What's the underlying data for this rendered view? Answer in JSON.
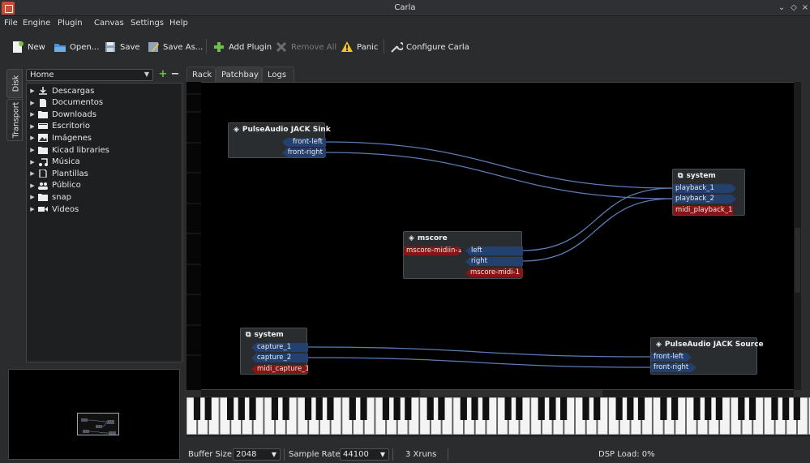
{
  "window": {
    "title": "Carla",
    "controls": [
      "⌄",
      "◇",
      "×"
    ]
  },
  "menubar": {
    "items": [
      "File",
      "Engine",
      "Plugin",
      "Canvas",
      "Settings",
      "Help"
    ]
  },
  "toolbar": {
    "new": "New",
    "open": "Open...",
    "save": "Save",
    "save_as": "Save As...",
    "add_plugin": "Add Plugin",
    "remove_all": "Remove All",
    "panic": "Panic",
    "configure": "Configure Carla"
  },
  "sidebar": {
    "tabs": [
      "Disk",
      "Transport"
    ],
    "path": "Home",
    "items": [
      {
        "label": "Descargas",
        "icon": "download-icon"
      },
      {
        "label": "Documentos",
        "icon": "document-icon"
      },
      {
        "label": "Downloads",
        "icon": "folder-icon"
      },
      {
        "label": "Escritorio",
        "icon": "desktop-icon"
      },
      {
        "label": "Imágenes",
        "icon": "image-icon"
      },
      {
        "label": "Kicad libraries",
        "icon": "folder-icon"
      },
      {
        "label": "Música",
        "icon": "music-icon"
      },
      {
        "label": "Plantillas",
        "icon": "template-icon"
      },
      {
        "label": "Público",
        "icon": "people-icon"
      },
      {
        "label": "snap",
        "icon": "folder-icon"
      },
      {
        "label": "Videos",
        "icon": "video-icon"
      }
    ]
  },
  "tabs": [
    "Rack",
    "Patchbay",
    "Logs"
  ],
  "patchbay": {
    "nodes": {
      "pulse_sink": {
        "title": "PulseAudio JACK Sink",
        "ports": [
          "front-left",
          "front-right"
        ]
      },
      "system_out": {
        "title": "system",
        "ports": [
          "playback_1",
          "playback_2",
          "midi_playback_1"
        ]
      },
      "mscore": {
        "title": "mscore",
        "in_ports": [
          "mscore-midiin-1"
        ],
        "out_ports": [
          "left",
          "right",
          "mscore-midi-1"
        ]
      },
      "system_in": {
        "title": "system",
        "ports": [
          "capture_1",
          "capture_2",
          "midi_capture_1"
        ]
      },
      "pulse_source": {
        "title": "PulseAudio JACK Source",
        "ports": [
          "front-left",
          "front-right"
        ]
      }
    },
    "colors": {
      "audio_port": "#23406e",
      "midi_port": "#8a1414",
      "connection": "#5b7bb5"
    }
  },
  "status": {
    "buffer_label": "Buffer Size:",
    "buffer_value": "2048",
    "rate_label": "Sample Rate:",
    "rate_value": "44100",
    "xruns": "3 Xruns",
    "dsp": "DSP Load: 0%"
  }
}
